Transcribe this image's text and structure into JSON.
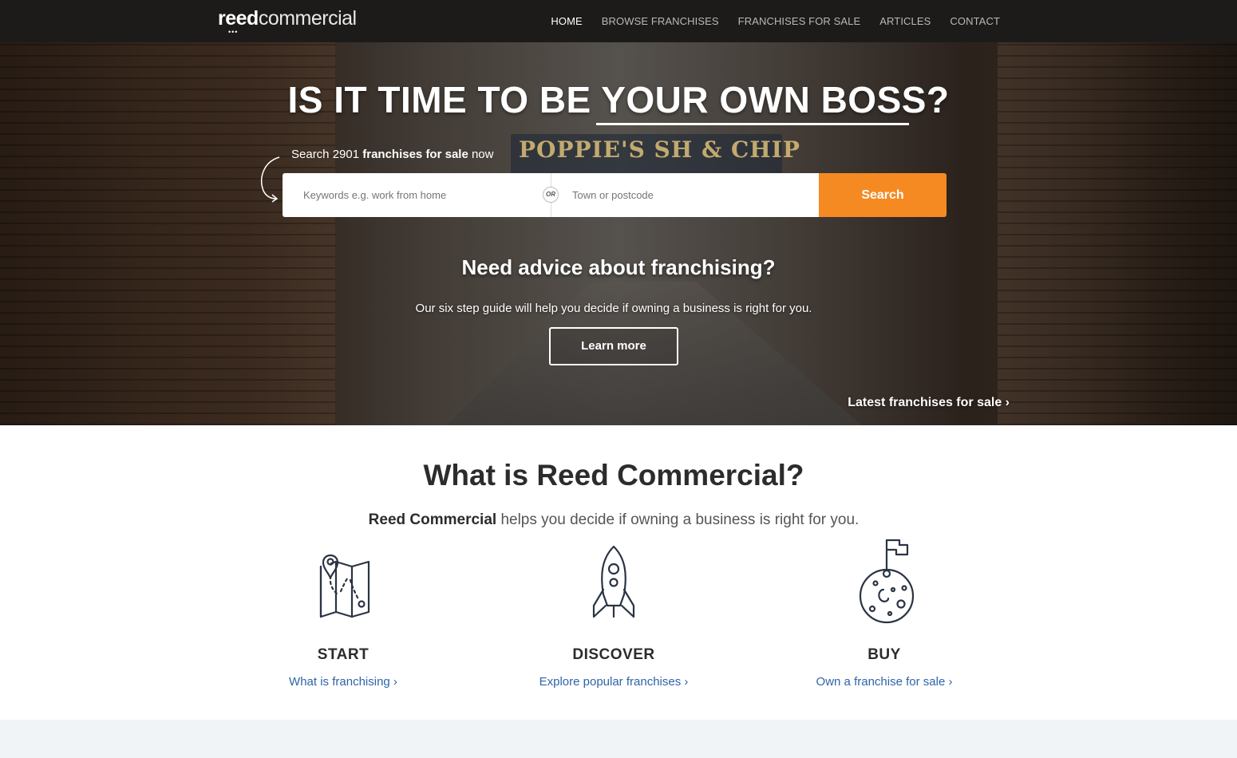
{
  "brand": {
    "logo_bold": "reed",
    "logo_thin": "commercial",
    "logo_dots": "•••"
  },
  "nav": {
    "items": [
      {
        "label": "HOME",
        "active": true
      },
      {
        "label": "BROWSE FRANCHISES",
        "active": false
      },
      {
        "label": "FRANCHISES FOR SALE",
        "active": false
      },
      {
        "label": "ARTICLES",
        "active": false
      },
      {
        "label": "CONTACT",
        "active": false
      }
    ]
  },
  "hero": {
    "title": "IS IT TIME TO BE YOUR OWN BOSS?",
    "background_sign": "POPPIE'S  SH & CHIP",
    "search_hint_pre": "Search 2901 ",
    "search_hint_bold": "franchises for sale",
    "search_hint_post": " now",
    "keywords_placeholder": "Keywords e.g. work from home",
    "or_label": "OR",
    "town_placeholder": "Town or postcode",
    "search_button": "Search",
    "advice_title": "Need advice about franchising?",
    "advice_text": "Our six step guide will help you decide if owning a business is right for you.",
    "learn_more": "Learn more",
    "latest_link": "Latest franchises for sale ›"
  },
  "about": {
    "title": "What is Reed Commercial?",
    "sub_bold": "Reed Commercial",
    "sub_rest": " helps you decide if owning a business is right for you.",
    "features": [
      {
        "icon": "map-icon",
        "heading": "START",
        "link": "What is franchising ›"
      },
      {
        "icon": "rocket-icon",
        "heading": "DISCOVER",
        "link": "Explore popular franchises ›"
      },
      {
        "icon": "moon-flag-icon",
        "heading": "BUY",
        "link": "Own a franchise for sale ›"
      }
    ]
  },
  "colors": {
    "accent": "#f68a22",
    "nav_bg": "#1c1b1a",
    "link": "#2e64a8",
    "icon_stroke": "#2a3444"
  }
}
